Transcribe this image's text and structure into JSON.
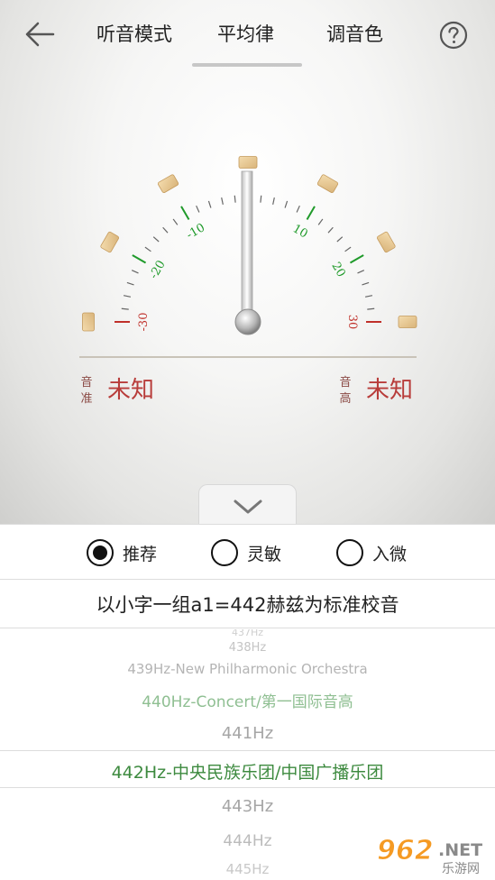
{
  "header": {
    "back_icon": "arrow-left-icon",
    "tabs": [
      {
        "label": "听音模式"
      },
      {
        "label": "平均律"
      },
      {
        "label": "调音色"
      }
    ],
    "active_tab": 1,
    "help_icon": "question-circle-icon"
  },
  "gauge": {
    "left_scale": [
      "-10",
      "-20",
      "-30"
    ],
    "right_scale": [
      "10",
      "20",
      "30"
    ],
    "needle_cents": 0,
    "left_label": "音准",
    "left_value": "未知",
    "right_label": "音高",
    "right_value": "未知",
    "colors": {
      "green": "#1f9a2a",
      "red": "#c0302a",
      "value": "#b83c3a"
    }
  },
  "expand_icon": "chevron-down-icon",
  "sensitivity": {
    "options": [
      {
        "label": "推荐",
        "selected": true
      },
      {
        "label": "灵敏",
        "selected": false
      },
      {
        "label": "入微",
        "selected": false
      }
    ]
  },
  "standard_text": "以小字一组a1=442赫兹为标准校音",
  "pitch_list": {
    "items": [
      "437Hz",
      "438Hz",
      "439Hz-New Philharmonic Orchestra",
      "440Hz-Concert/第一国际音高",
      "441Hz",
      "442Hz-中央民族乐团/中国广播乐团",
      "443Hz",
      "444Hz",
      "445Hz"
    ],
    "selected_index": 5
  },
  "watermark": {
    "logo": "962",
    "suffix": ".NET",
    "sub": "乐游网"
  }
}
